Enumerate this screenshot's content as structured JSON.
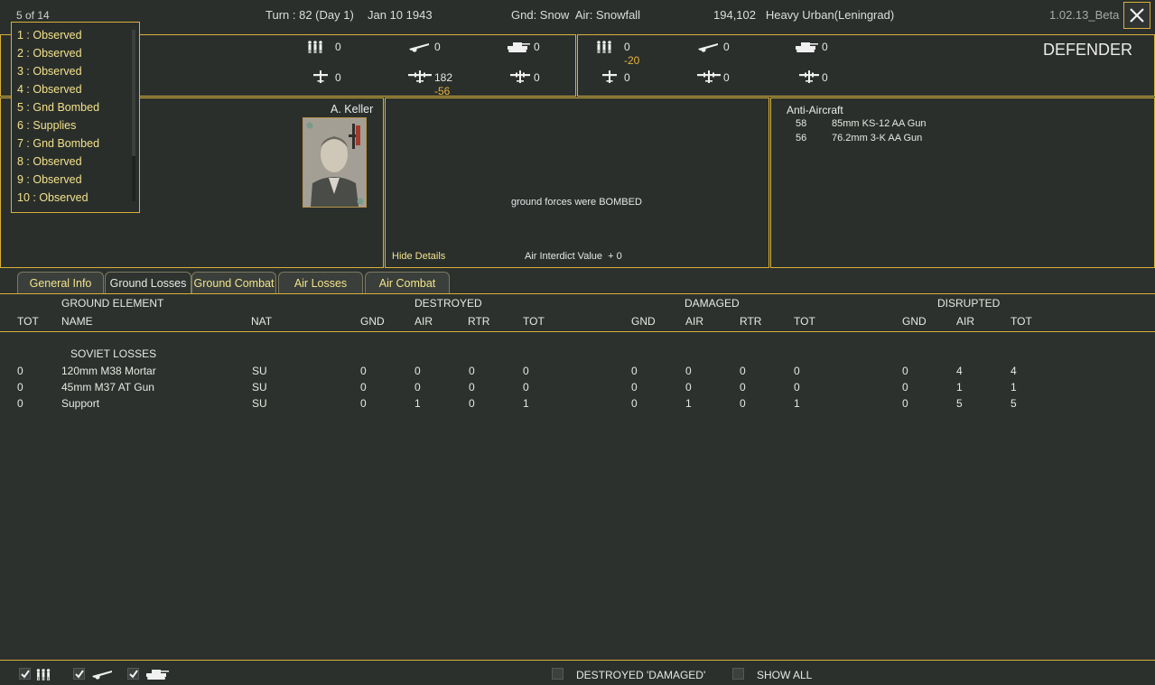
{
  "header": {
    "counter": "5 of 14",
    "turn": "Turn : 82 (Day 1)",
    "date": "Jan 10 1943",
    "weather": "Gnd: Snow  Air: Snowfall",
    "location": "194,102   Heavy Urban(Leningrad)",
    "version": "1.02.13_Beta"
  },
  "dropdown": {
    "items": [
      "1 : Observed",
      "2 : Observed",
      "3 : Observed",
      "4 : Observed",
      "5 : Gnd Bombed",
      "6 : Supplies",
      "7 : Gnd Bombed",
      "8 : Observed",
      "9 : Observed",
      "10 : Observed"
    ]
  },
  "attacker": {
    "infantry": "0",
    "fighter": "0",
    "tank": "0",
    "aircraft1": "0",
    "aircraft2": "182",
    "aircraft2_delta": "-56",
    "aircraft3": "0"
  },
  "defender": {
    "label": "DEFENDER",
    "infantry": "0",
    "infantry_delta": "-20",
    "fighter": "0",
    "tank": "0",
    "aircraft1": "0",
    "aircraft2": "0",
    "aircraft3": "0"
  },
  "commander": {
    "name": "A. Keller"
  },
  "combat": {
    "message": "ground forces were BOMBED",
    "hide_details": "Hide Details",
    "air_interdict": "Air Interdict Value  + 0"
  },
  "antiair": {
    "title": "Anti-Aircraft",
    "rows": [
      {
        "count": "58",
        "name": "85mm KS-12 AA Gun"
      },
      {
        "count": "56",
        "name": "76.2mm 3-K AA Gun"
      }
    ]
  },
  "tabs": [
    "General Info",
    "Ground Losses",
    "Ground Combat",
    "Air Losses",
    "Air Combat"
  ],
  "table": {
    "group_headers": {
      "element": "GROUND ELEMENT",
      "destroyed": "DESTROYED",
      "damaged": "DAMAGED",
      "disrupted": "DISRUPTED"
    },
    "columns": {
      "tot": "TOT",
      "name": "NAME",
      "nat": "NAT",
      "gnd": "GND",
      "air": "AIR",
      "rtr": "RTR"
    },
    "section_title": "SOVIET LOSSES",
    "rows": [
      {
        "tot": "0",
        "name": "120mm M38 Mortar",
        "nat": "SU",
        "d_gnd": "0",
        "d_air": "0",
        "d_rtr": "0",
        "d_tot": "0",
        "m_gnd": "0",
        "m_air": "0",
        "m_rtr": "0",
        "m_tot": "0",
        "s_gnd": "0",
        "s_air": "4",
        "s_tot": "4"
      },
      {
        "tot": "0",
        "name": "45mm M37 AT Gun",
        "nat": "SU",
        "d_gnd": "0",
        "d_air": "0",
        "d_rtr": "0",
        "d_tot": "0",
        "m_gnd": "0",
        "m_air": "0",
        "m_rtr": "0",
        "m_tot": "0",
        "s_gnd": "0",
        "s_air": "1",
        "s_tot": "1"
      },
      {
        "tot": "0",
        "name": "Support",
        "nat": "SU",
        "d_gnd": "0",
        "d_air": "1",
        "d_rtr": "0",
        "d_tot": "1",
        "m_gnd": "0",
        "m_air": "1",
        "m_rtr": "0",
        "m_tot": "1",
        "s_gnd": "0",
        "s_air": "5",
        "s_tot": "5"
      }
    ]
  },
  "footer": {
    "destroyed_damaged": "DESTROYED 'DAMAGED'",
    "show_all": "SHOW ALL"
  },
  "colors": {
    "border": "#d8b13a",
    "loss": "#e8b43a",
    "option": "#f2e38a"
  }
}
